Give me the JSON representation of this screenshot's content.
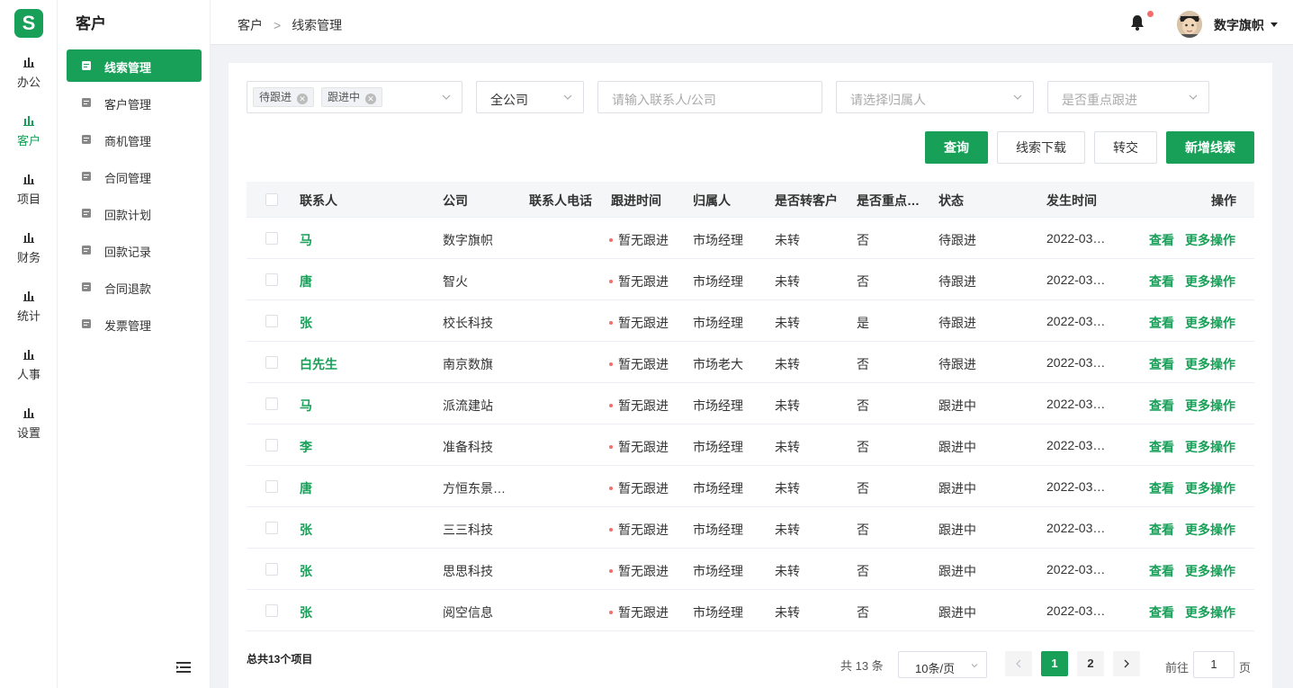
{
  "app": {
    "logo": "S"
  },
  "rail": [
    {
      "label": "办公",
      "active": false
    },
    {
      "label": "客户",
      "active": true
    },
    {
      "label": "项目",
      "active": false
    },
    {
      "label": "财务",
      "active": false
    },
    {
      "label": "统计",
      "active": false
    },
    {
      "label": "人事",
      "active": false
    },
    {
      "label": "设置",
      "active": false
    }
  ],
  "submenu": {
    "title": "客户",
    "items": [
      {
        "label": "线索管理",
        "icon": "sort-icon",
        "active": true
      },
      {
        "label": "客户管理",
        "icon": "users-icon",
        "active": false
      },
      {
        "label": "商机管理",
        "icon": "briefcase-icon",
        "active": false
      },
      {
        "label": "合同管理",
        "icon": "contract-icon",
        "active": false
      },
      {
        "label": "回款计划",
        "icon": "plan-icon",
        "active": false
      },
      {
        "label": "回款记录",
        "icon": "record-icon",
        "active": false
      },
      {
        "label": "合同退款",
        "icon": "refund-icon",
        "active": false
      },
      {
        "label": "发票管理",
        "icon": "invoice-icon",
        "active": false
      }
    ]
  },
  "header": {
    "breadcrumb": [
      "客户",
      "线索管理"
    ],
    "breadcrumb_sep": ">",
    "username": "数字旗帜"
  },
  "filters": {
    "status_tags": [
      "待跟进",
      "跟进中"
    ],
    "company": "全公司",
    "contact_placeholder": "请输入联系人/公司",
    "owner_placeholder": "请选择归属人",
    "key_placeholder": "是否重点跟进"
  },
  "actions": {
    "query": "查询",
    "download": "线索下载",
    "transfer": "转交",
    "add": "新增线索"
  },
  "table": {
    "columns": [
      "联系人",
      "公司",
      "联系人电话",
      "跟进时间",
      "归属人",
      "是否转客户",
      "是否重点…",
      "状态",
      "发生时间",
      "操作"
    ],
    "view_label": "查看",
    "more_label": "更多操作",
    "rows": [
      {
        "contact": "马",
        "company": "数字旗帜",
        "phone": "",
        "follow": "暂无跟进",
        "owner": "市场经理",
        "converted": "未转",
        "key": "否",
        "status": "待跟进",
        "time": "2022-03…"
      },
      {
        "contact": "唐",
        "company": "智火",
        "phone": "",
        "follow": "暂无跟进",
        "owner": "市场经理",
        "converted": "未转",
        "key": "否",
        "status": "待跟进",
        "time": "2022-03…"
      },
      {
        "contact": "张",
        "company": "校长科技",
        "phone": "",
        "follow": "暂无跟进",
        "owner": "市场经理",
        "converted": "未转",
        "key": "是",
        "status": "待跟进",
        "time": "2022-03…"
      },
      {
        "contact": "白先生",
        "company": "南京数旗",
        "phone": "",
        "follow": "暂无跟进",
        "owner": "市场老大",
        "converted": "未转",
        "key": "否",
        "status": "待跟进",
        "time": "2022-03…"
      },
      {
        "contact": "马",
        "company": "派流建站",
        "phone": "",
        "follow": "暂无跟进",
        "owner": "市场经理",
        "converted": "未转",
        "key": "否",
        "status": "跟进中",
        "time": "2022-03…"
      },
      {
        "contact": "李",
        "company": "准备科技",
        "phone": "",
        "follow": "暂无跟进",
        "owner": "市场经理",
        "converted": "未转",
        "key": "否",
        "status": "跟进中",
        "time": "2022-03…"
      },
      {
        "contact": "唐",
        "company": "方恒东景…",
        "phone": "",
        "follow": "暂无跟进",
        "owner": "市场经理",
        "converted": "未转",
        "key": "否",
        "status": "跟进中",
        "time": "2022-03…"
      },
      {
        "contact": "张",
        "company": "三三科技",
        "phone": "",
        "follow": "暂无跟进",
        "owner": "市场经理",
        "converted": "未转",
        "key": "否",
        "status": "跟进中",
        "time": "2022-03…"
      },
      {
        "contact": "张",
        "company": "思思科技",
        "phone": "",
        "follow": "暂无跟进",
        "owner": "市场经理",
        "converted": "未转",
        "key": "否",
        "status": "跟进中",
        "time": "2022-03…"
      },
      {
        "contact": "张",
        "company": "阅空信息",
        "phone": "",
        "follow": "暂无跟进",
        "owner": "市场经理",
        "converted": "未转",
        "key": "否",
        "status": "跟进中",
        "time": "2022-03…"
      }
    ]
  },
  "pagination": {
    "total_label": "总共13个项目",
    "count_label": "共 13 条",
    "page_size": "10条/页",
    "pages": [
      "1",
      "2"
    ],
    "current": "1",
    "goto_label": "前往",
    "goto_value": "1",
    "goto_unit": "页"
  },
  "colors": {
    "accent": "#18a058",
    "dot": "#f56c6c"
  }
}
